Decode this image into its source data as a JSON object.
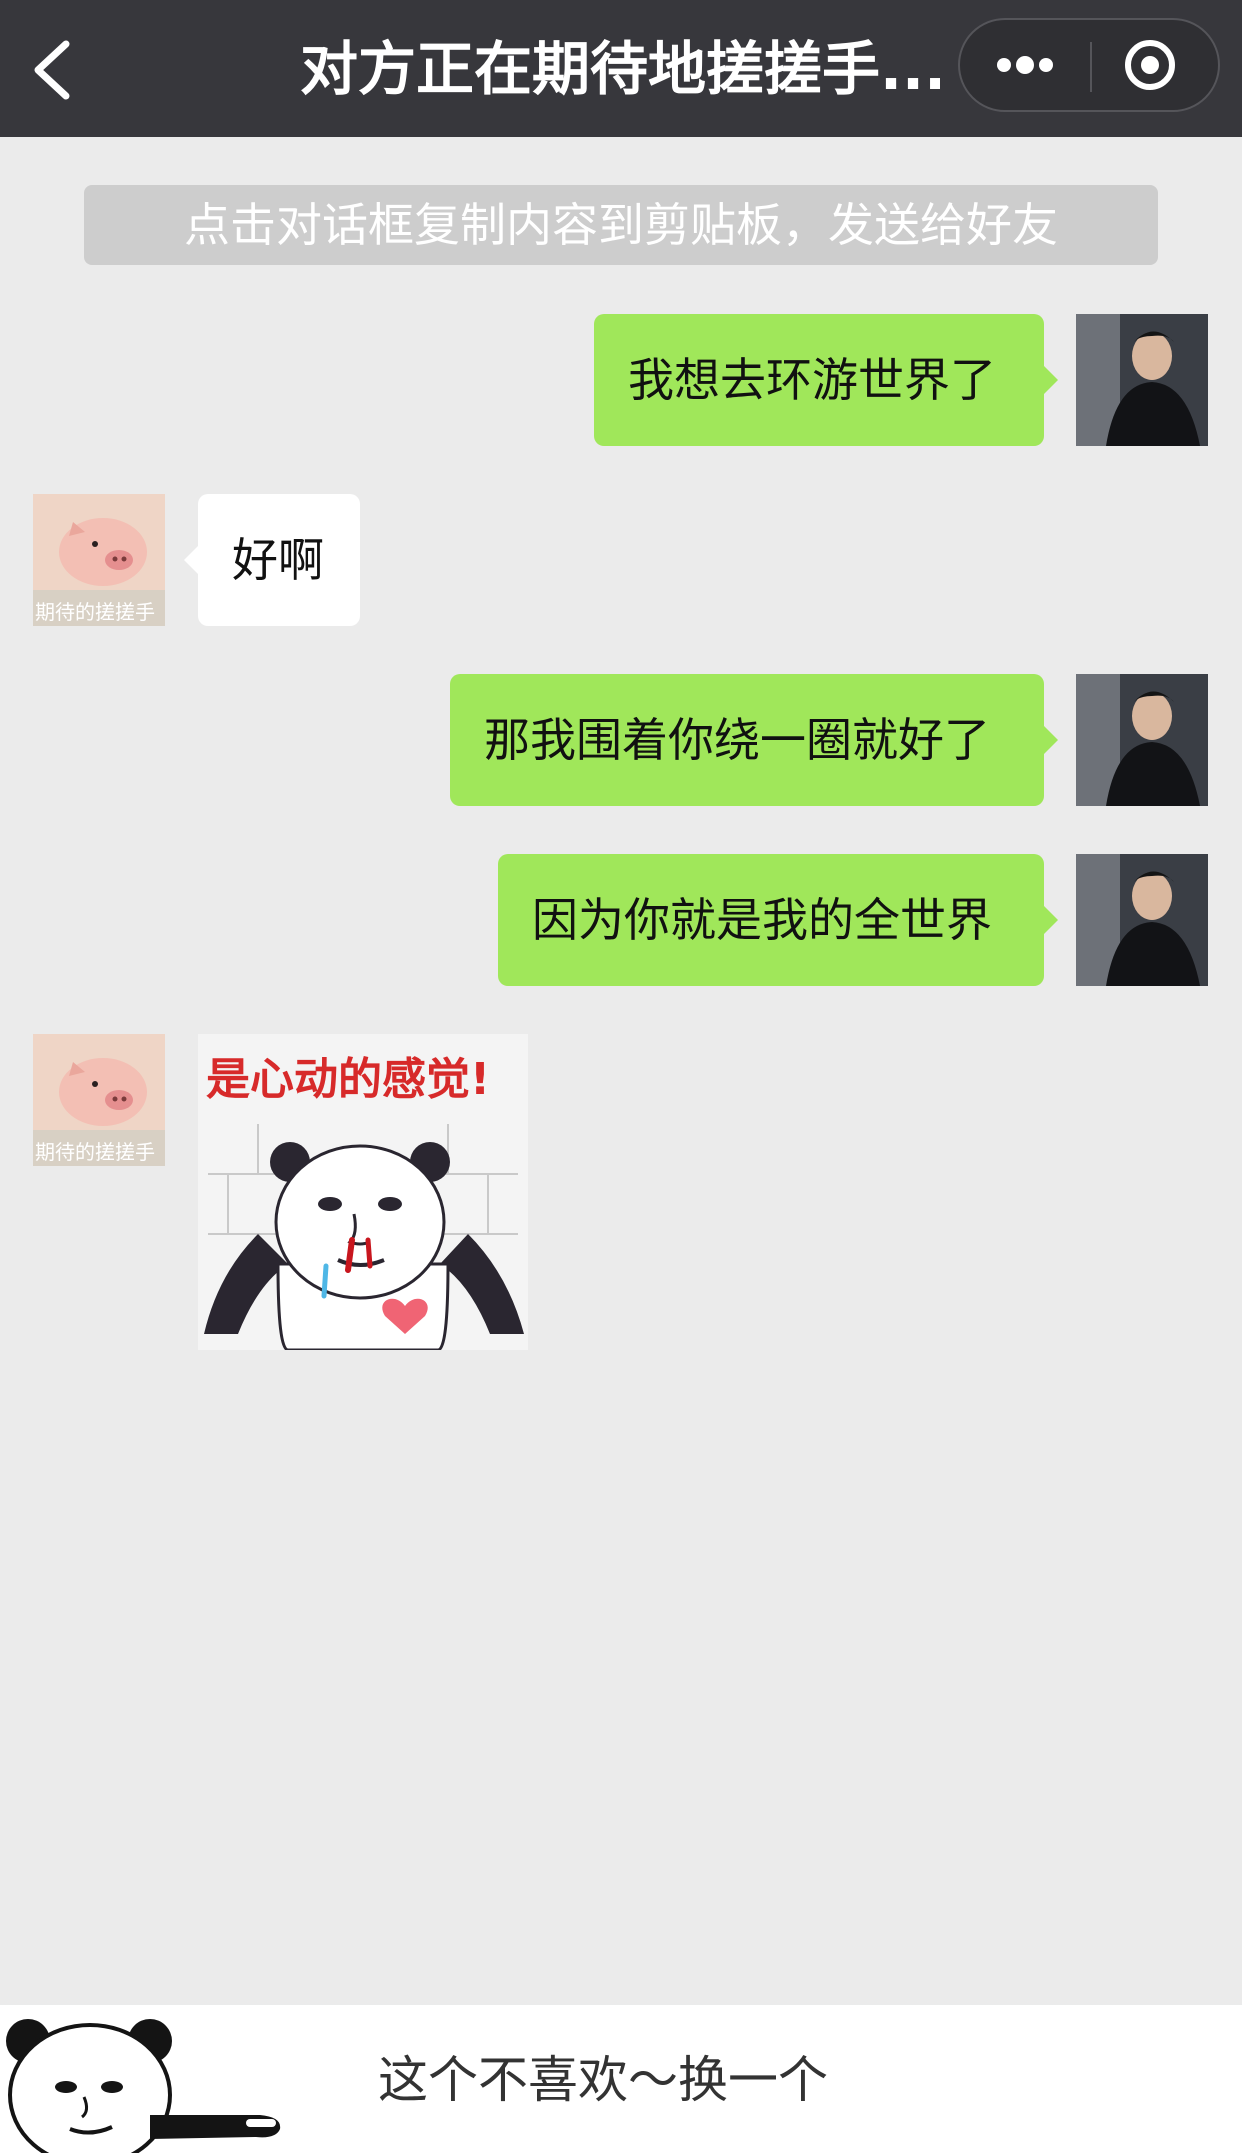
{
  "navbar": {
    "title": "对方正在期待地搓搓手...",
    "back_icon": "chevron-left-icon",
    "more_icon": "more-dots-icon",
    "close_icon": "record-circle-icon"
  },
  "tip": {
    "text": "点击对话框复制内容到剪贴板，发送给好友"
  },
  "messages": [
    {
      "side": "right",
      "text": "我想去环游世界了"
    },
    {
      "side": "left",
      "text": "好啊"
    },
    {
      "side": "right",
      "text": "那我围着你绕一圈就好了"
    },
    {
      "side": "right",
      "text": "因为你就是我的全世界"
    },
    {
      "side": "left",
      "type": "sticker",
      "caption": "是心动的感觉!"
    }
  ],
  "avatars": {
    "friend_label": "期待的搓搓手"
  },
  "bottom": {
    "text": "这个不喜欢～换一个"
  },
  "colors": {
    "navbar": "#37373c",
    "background": "#ebebeb",
    "bubble_self": "#a0e75a",
    "bubble_friend": "#ffffff",
    "tip_bg": "#cdcdcd"
  }
}
